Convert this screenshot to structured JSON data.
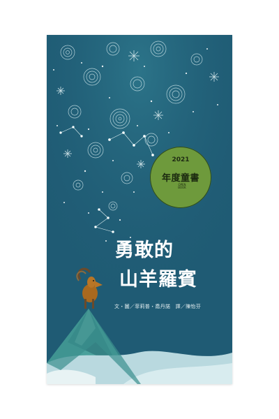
{
  "cover": {
    "title_line1": "勇敢的",
    "title_line2": "山羊羅賓",
    "credits": "文・圖／菲莉普・喬丹諾　譯／陳怡芬"
  },
  "badge": {
    "year": "2021",
    "label": "年度童書",
    "publisher_mark": "OPEN BOOK"
  },
  "colors": {
    "background": "#1f5b74",
    "badge": "#6e9a3c",
    "mountain": "#3a8a8c"
  }
}
